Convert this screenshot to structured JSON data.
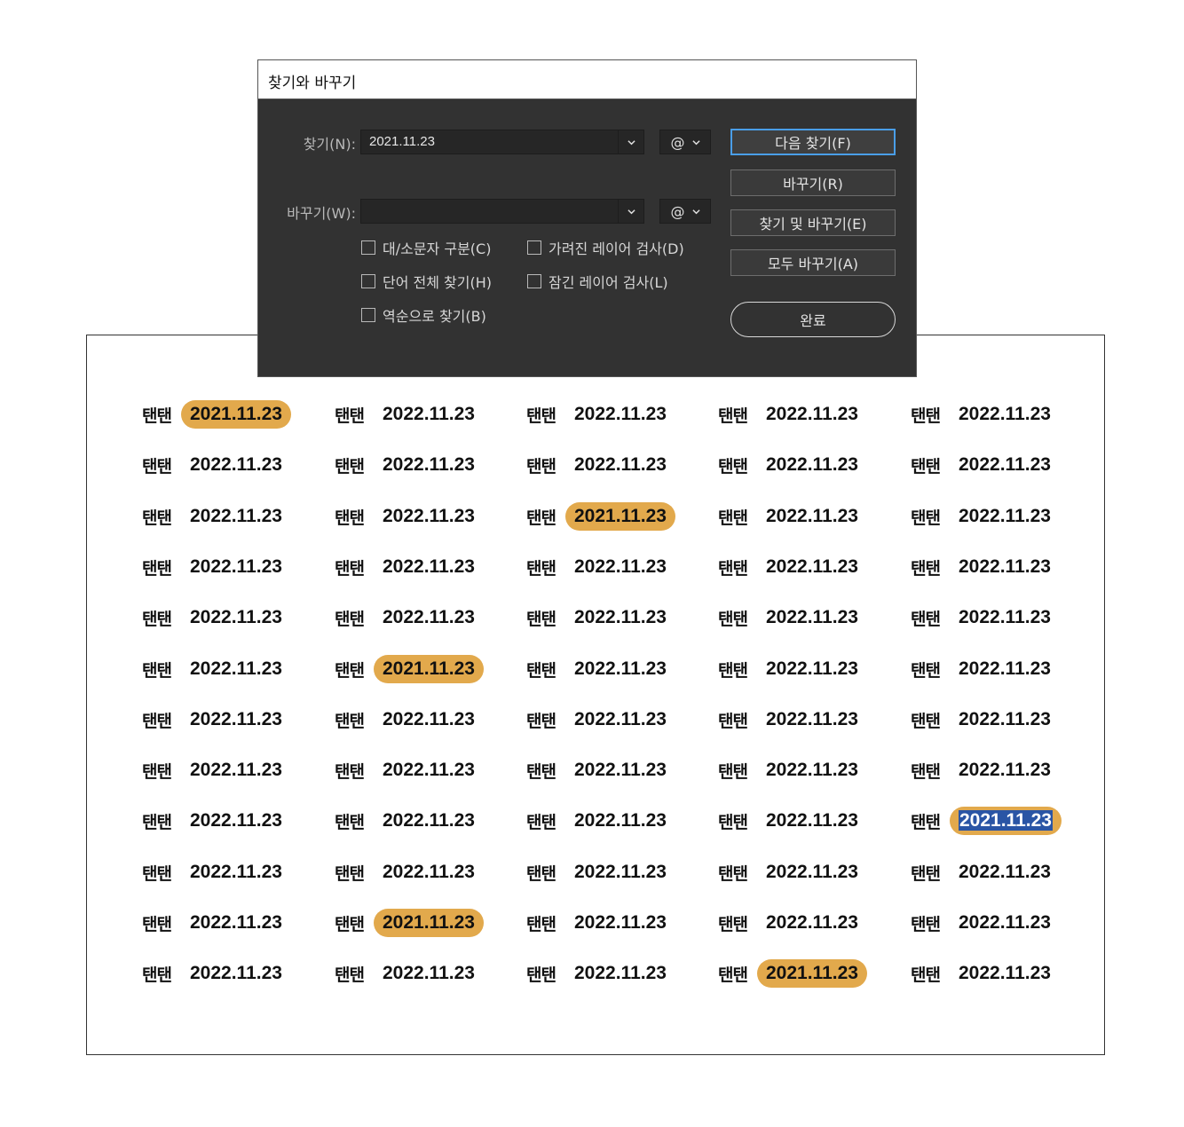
{
  "dialog": {
    "title": "찾기와 바꾸기",
    "find_label": "찾기(N):",
    "find_value": "2021.11.23",
    "replace_label": "바꾸기(W):",
    "replace_value": "",
    "special_char": "@",
    "options": {
      "match_case": "대/소문자 구분(C)",
      "whole_word": "단어 전체 찾기(H)",
      "backwards": "역순으로 찾기(B)",
      "hidden_layers": "가려진 레이어 검사(D)",
      "locked_layers": "잠긴 레이어 검사(L)"
    },
    "buttons": {
      "find_next": "다음 찾기(F)",
      "replace": "바꾸기(R)",
      "find_replace": "찾기 및 바꾸기(E)",
      "replace_all": "모두 바꾸기(A)",
      "done": "완료"
    }
  },
  "document": {
    "name_text": "탠탠",
    "rows": [
      [
        "2021.11.23",
        "2022.11.23",
        "2022.11.23",
        "2022.11.23",
        "2022.11.23"
      ],
      [
        "2022.11.23",
        "2022.11.23",
        "2022.11.23",
        "2022.11.23",
        "2022.11.23"
      ],
      [
        "2022.11.23",
        "2022.11.23",
        "2021.11.23",
        "2022.11.23",
        "2022.11.23"
      ],
      [
        "2022.11.23",
        "2022.11.23",
        "2022.11.23",
        "2022.11.23",
        "2022.11.23"
      ],
      [
        "2022.11.23",
        "2022.11.23",
        "2022.11.23",
        "2022.11.23",
        "2022.11.23"
      ],
      [
        "2022.11.23",
        "2021.11.23",
        "2022.11.23",
        "2022.11.23",
        "2022.11.23"
      ],
      [
        "2022.11.23",
        "2022.11.23",
        "2022.11.23",
        "2022.11.23",
        "2022.11.23"
      ],
      [
        "2022.11.23",
        "2022.11.23",
        "2022.11.23",
        "2022.11.23",
        "2022.11.23"
      ],
      [
        "2022.11.23",
        "2022.11.23",
        "2022.11.23",
        "2022.11.23",
        "2021.11.23"
      ],
      [
        "2022.11.23",
        "2022.11.23",
        "2022.11.23",
        "2022.11.23",
        "2022.11.23"
      ],
      [
        "2022.11.23",
        "2021.11.23",
        "2022.11.23",
        "2022.11.23",
        "2022.11.23"
      ],
      [
        "2022.11.23",
        "2022.11.23",
        "2022.11.23",
        "2021.11.23",
        "2022.11.23"
      ]
    ],
    "highlight_match": "2021.11.23",
    "selected_cell": [
      8,
      4
    ],
    "colors": {
      "highlight": "#e2a94c",
      "selection": "#2a55a5"
    }
  }
}
